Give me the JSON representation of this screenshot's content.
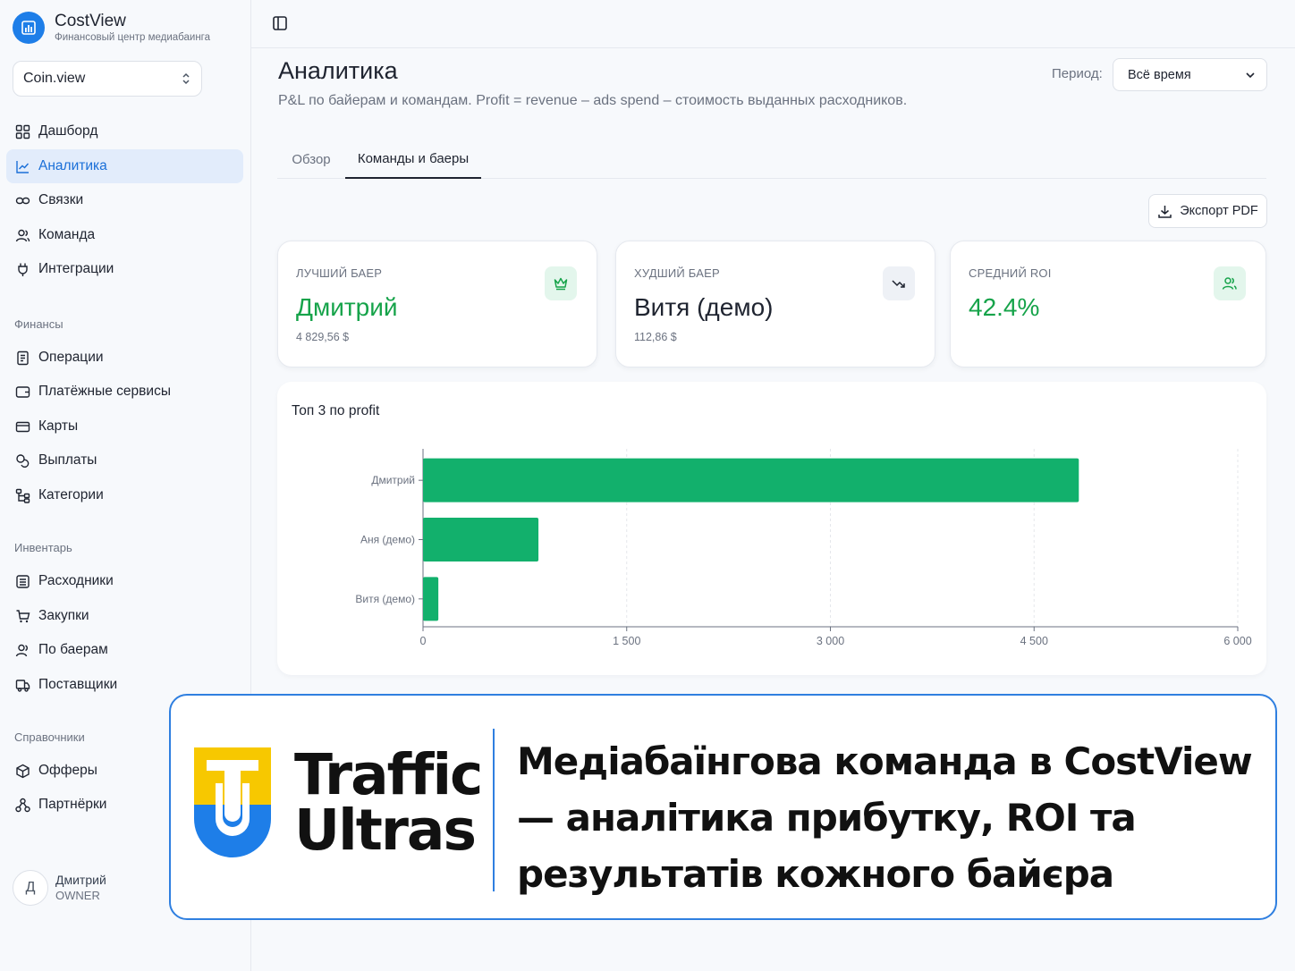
{
  "app": {
    "name": "CostView",
    "subtitle": "Финансовый центр медиабаинга"
  },
  "workspace": {
    "selected": "Coin.view"
  },
  "nav": {
    "main": [
      {
        "label": "Дашборд",
        "icon": "dashboard-icon"
      },
      {
        "label": "Аналитика",
        "icon": "chart-line-icon",
        "active": true
      },
      {
        "label": "Связки",
        "icon": "link-icon"
      },
      {
        "label": "Команда",
        "icon": "users-icon"
      },
      {
        "label": "Интеграции",
        "icon": "plug-icon"
      }
    ],
    "finance_title": "Финансы",
    "finance": [
      {
        "label": "Операции",
        "icon": "receipt-icon"
      },
      {
        "label": "Платёжные сервисы",
        "icon": "wallet-icon"
      },
      {
        "label": "Карты",
        "icon": "credit-card-icon"
      },
      {
        "label": "Выплаты",
        "icon": "coins-icon"
      },
      {
        "label": "Категории",
        "icon": "tree-icon"
      }
    ],
    "inventory_title": "Инвентарь",
    "inventory": [
      {
        "label": "Расходники",
        "icon": "box-icon"
      },
      {
        "label": "Закупки",
        "icon": "cart-icon"
      },
      {
        "label": "По баерам",
        "icon": "user-icon"
      },
      {
        "label": "Поставщики",
        "icon": "truck-icon"
      }
    ],
    "refs_title": "Справочники",
    "refs": [
      {
        "label": "Офферы",
        "icon": "package-icon"
      },
      {
        "label": "Партнёрки",
        "icon": "network-icon"
      }
    ]
  },
  "user": {
    "initial": "Д",
    "name": "Дмитрий",
    "role": "OWNER"
  },
  "page": {
    "title": "Аналитика",
    "subtitle": "P&L по байерам и командам. Profit = revenue – ads spend – стоимость выданных расходников.",
    "period_label": "Период:",
    "period_value": "Всё время",
    "tabs": [
      {
        "label": "Обзор"
      },
      {
        "label": "Команды и баеры",
        "active": true
      }
    ],
    "export_label": "Экспорт PDF"
  },
  "cards": [
    {
      "label": "ЛУЧШИЙ БАЕР",
      "value": "Дмитрий",
      "sub": "4 829,56 $",
      "value_color": "#16a34a",
      "icon": "crown-icon"
    },
    {
      "label": "ХУДШИЙ БАЕР",
      "value": "Витя (демо)",
      "sub": "112,86 $",
      "value_color": "#1f2430",
      "icon": "trending-down-icon"
    },
    {
      "label": "СРЕДНИЙ ROI",
      "value": "42.4%",
      "sub": "",
      "value_color": "#16a34a",
      "icon": "users-icon"
    }
  ],
  "chart_data": {
    "type": "bar",
    "orientation": "horizontal",
    "title": "Топ 3 по profit",
    "categories": [
      "Дмитрий",
      "Аня (демо)",
      "Витя (демо)"
    ],
    "values": [
      4829.56,
      850,
      112.86
    ],
    "xlim": [
      0,
      6000
    ],
    "xticks": [
      0,
      1500,
      3000,
      4500,
      6000
    ],
    "xtick_labels": [
      "0",
      "1 500",
      "3 000",
      "4 500",
      "6 000"
    ],
    "grid": true,
    "bar_color": "#12b06c"
  },
  "banner": {
    "brand_line1": "Traffic",
    "brand_line2": "Ultras",
    "text": "Медіабаїнгова команда в CostView — аналітика прибутку, ROI та результатів кожного байєра",
    "accent": "#2f7fe0",
    "logo_colors": [
      "#f7c800",
      "#1e7ee8"
    ]
  }
}
